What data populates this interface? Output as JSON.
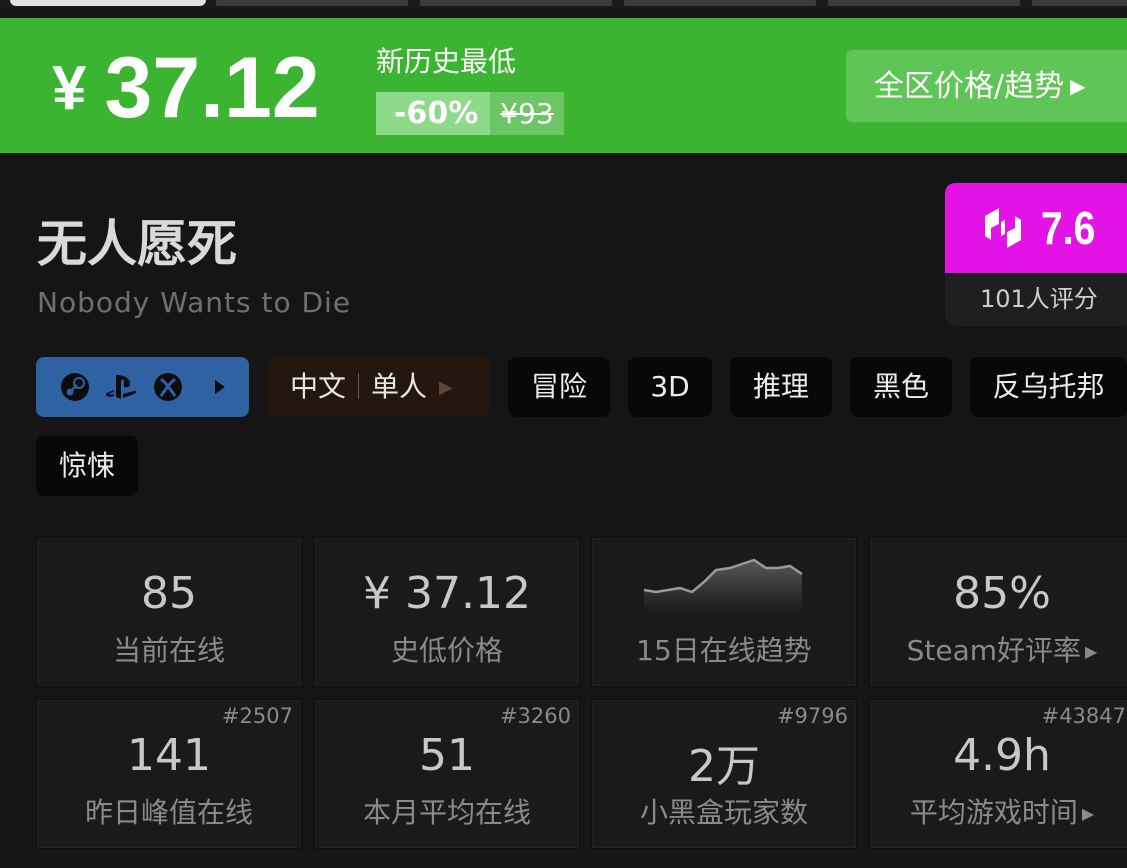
{
  "banner": {
    "currency": "¥",
    "price": "37.12",
    "low_label": "新历史最低",
    "discount": "-60%",
    "original_price": "¥93",
    "region_button": "全区价格/趋势"
  },
  "game": {
    "title": "无人愿死",
    "subtitle": "Nobody Wants to Die"
  },
  "score": {
    "value": "7.6",
    "count": "101人评分"
  },
  "platforms": [
    "steam-icon",
    "playstation-icon",
    "xbox-icon"
  ],
  "language_tag": {
    "lang": "中文",
    "mode": "单人"
  },
  "tags": [
    "冒险",
    "3D",
    "推理",
    "黑色",
    "反乌托邦",
    "惊悚"
  ],
  "stats": [
    {
      "value": "85",
      "label": "当前在线"
    },
    {
      "value": "¥ 37.12",
      "label": "史低价格"
    },
    {
      "value": "",
      "label": "15日在线趋势"
    },
    {
      "value": "85%",
      "label": "Steam好评率"
    },
    {
      "value": "141",
      "label": "昨日峰值在线",
      "rank": "#2507"
    },
    {
      "value": "51",
      "label": "本月平均在线",
      "rank": "#3260"
    },
    {
      "value": "2万",
      "label": "小黑盒玩家数",
      "rank": "#9796"
    },
    {
      "value": "4.9h",
      "label": "平均游戏时间",
      "rank": "#43847"
    }
  ],
  "colors": {
    "banner": "#3bb431",
    "score": "#e312e6",
    "platforms": "#2e62a3"
  }
}
